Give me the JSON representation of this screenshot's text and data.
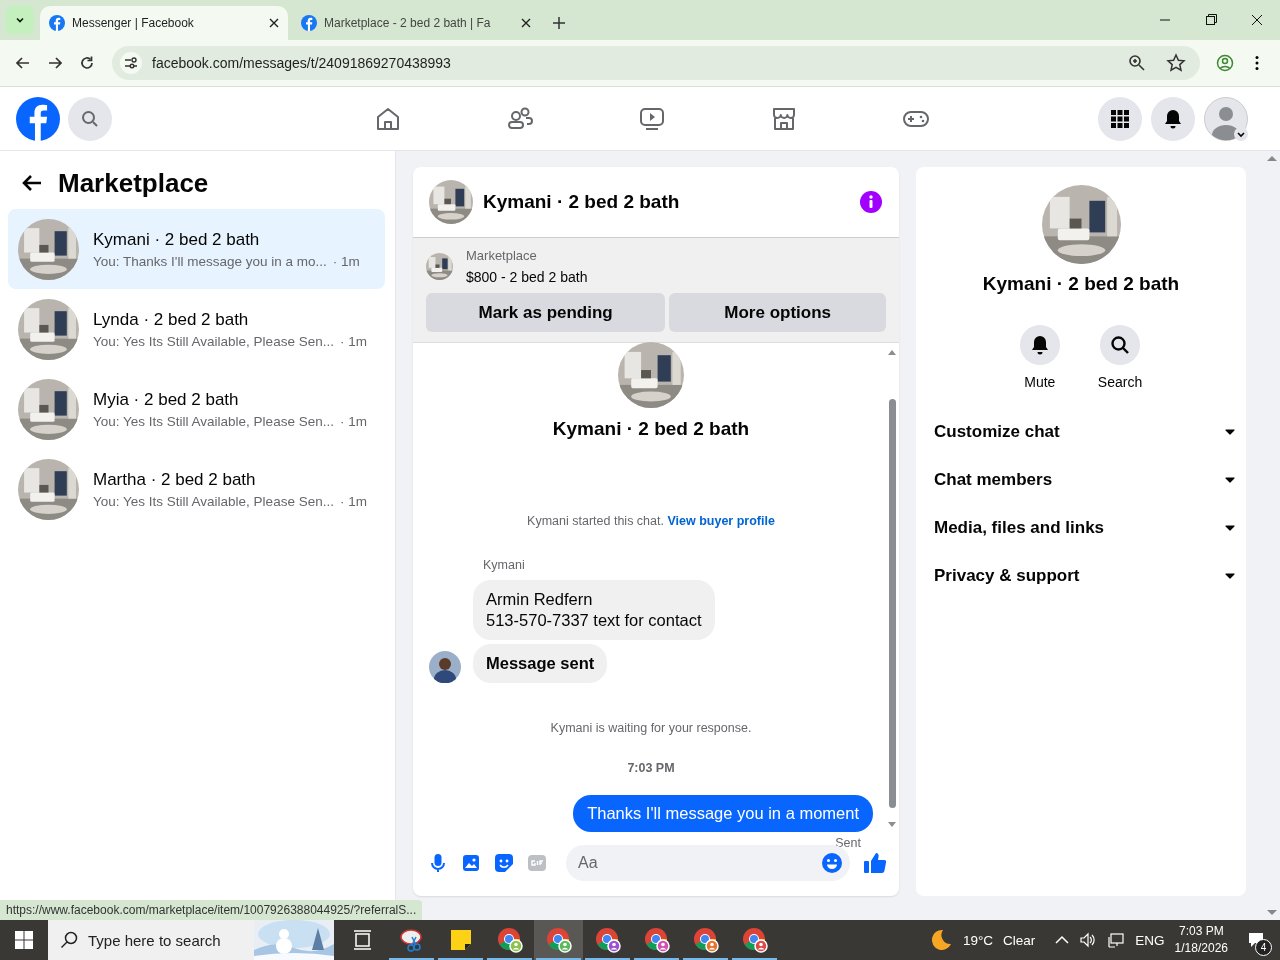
{
  "browser": {
    "tabs": [
      {
        "title": "Messenger | Facebook",
        "selected": true
      },
      {
        "title": "Marketplace - 2 bed 2 bath | Fa",
        "selected": false
      }
    ],
    "url": "facebook.com/messages/t/24091869270438993",
    "status_url": "https://www.facebook.com/marketplace/item/1007926388044925/?referralS..."
  },
  "sidebar": {
    "title": "Marketplace",
    "conversations": [
      {
        "name": "Kymani · 2 bed 2 bath",
        "preview": "You: Thanks I'll message you in a mo...",
        "time": "· 1m",
        "selected": true
      },
      {
        "name": "Lynda · 2 bed 2 bath",
        "preview": "You: Yes Its Still Available, Please Sen...",
        "time": "· 1m",
        "selected": false
      },
      {
        "name": "Myia · 2 bed 2 bath",
        "preview": "You: Yes Its Still Available, Please Sen...",
        "time": "· 1m",
        "selected": false
      },
      {
        "name": "Martha · 2 bed 2 bath",
        "preview": "You: Yes Its Still Available, Please Sen...",
        "time": "· 1m",
        "selected": false
      }
    ]
  },
  "chat": {
    "title": "Kymani · 2 bed 2 bath",
    "listing": {
      "label": "Marketplace",
      "title": "$800 - 2 bed 2 bath"
    },
    "buttons": [
      "Mark as pending",
      "More options"
    ],
    "intro_name": "Kymani · 2 bed 2 bath",
    "started": {
      "text": "Kymani started this chat.",
      "link": "View buyer profile"
    },
    "sender": "Kymani",
    "incoming": [
      {
        "lines": [
          "Armin Redfern",
          "513-570-7337 text for contact"
        ],
        "bold": false
      },
      {
        "lines": [
          "Message sent"
        ],
        "bold": true
      }
    ],
    "waiting": "Kymani is waiting for your response.",
    "time": "7:03 PM",
    "outgoing": "Thanks I'll message you in a moment",
    "status": "Sent",
    "composer": {
      "placeholder": "Aa"
    }
  },
  "details": {
    "name": "Kymani · 2 bed 2 bath",
    "actions": [
      {
        "kind": "mute",
        "label": "Mute"
      },
      {
        "kind": "search",
        "label": "Search"
      }
    ],
    "sections": [
      "Customize chat",
      "Chat members",
      "Media, files and links",
      "Privacy & support"
    ]
  },
  "taskbar": {
    "search_placeholder": "Type here to search",
    "temperature": "19°C",
    "condition": "Clear",
    "language": "ENG",
    "time": "7:03 PM",
    "date": "1/18/2026",
    "notifications": "4"
  }
}
